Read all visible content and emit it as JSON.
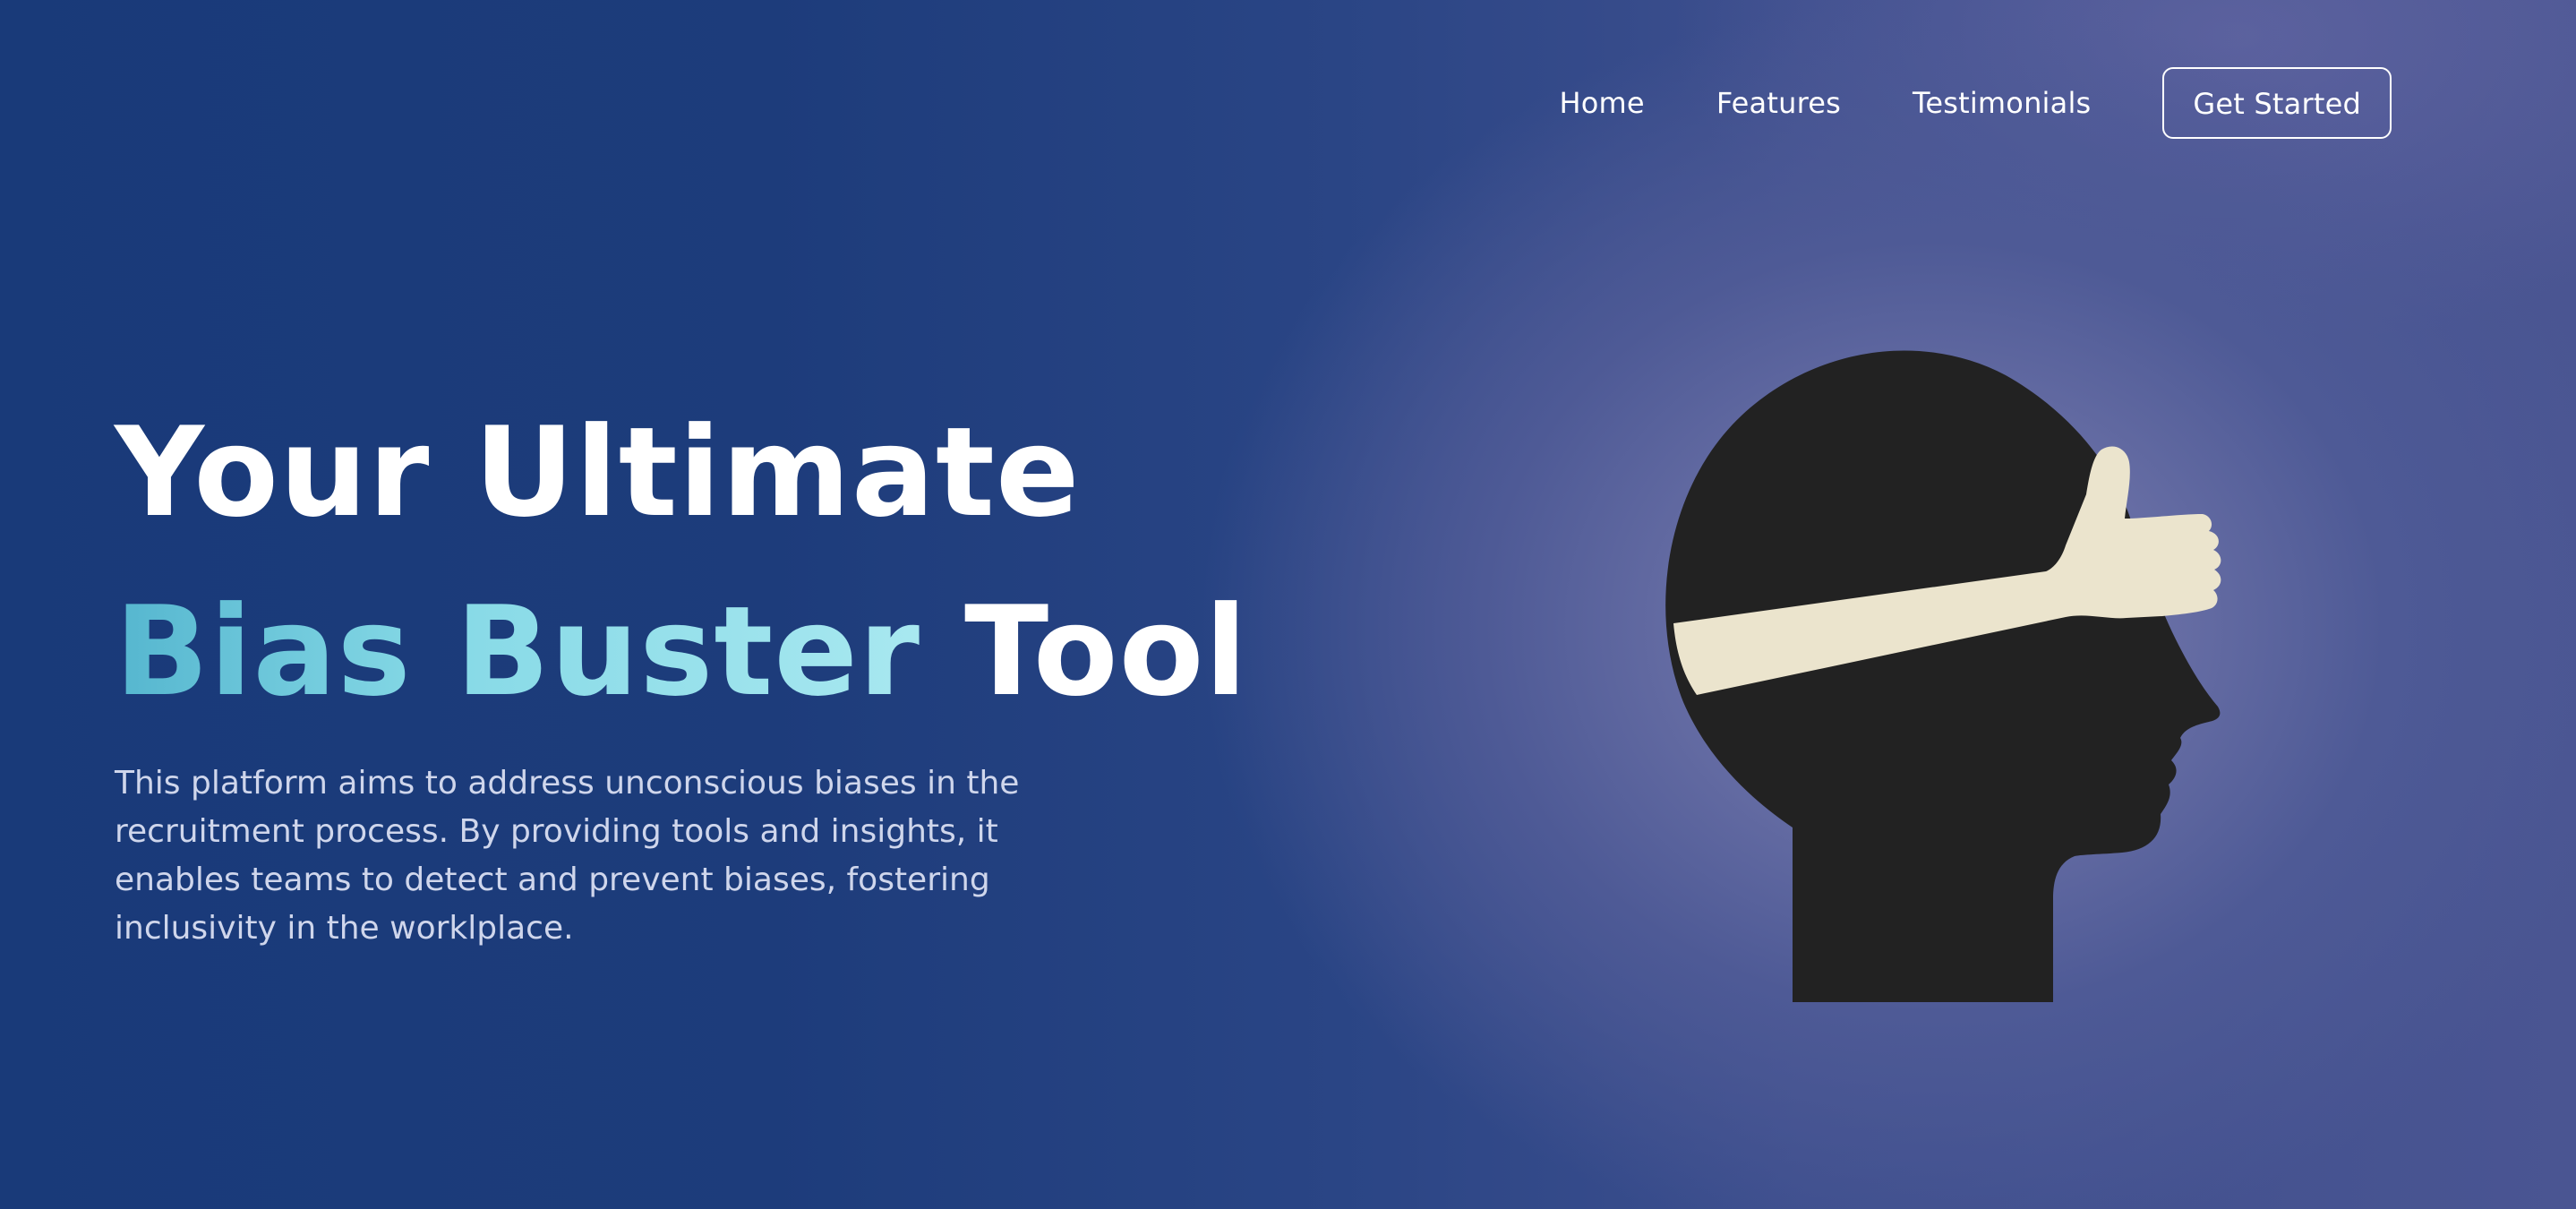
{
  "nav": {
    "links": [
      "Home",
      "Features",
      "Testimonials"
    ],
    "cta": "Get Started"
  },
  "hero": {
    "title_line1": "Your Ultimate",
    "title_accent": "Bias Buster",
    "title_end": "Tool",
    "description": "This platform aims to address unconscious biases in the recruitment process. By providing tools and insights, it enables teams to detect and prevent biases, fostering inclusivity in the worklplace."
  },
  "illustration": {
    "icon": "blindfolded-head-icon",
    "head_color": "#222222",
    "hand_color": "#ebe4cd"
  },
  "colors": {
    "background": "#1c3a78",
    "accent_start": "#55b6cf",
    "accent_end": "#a8e8f0"
  }
}
